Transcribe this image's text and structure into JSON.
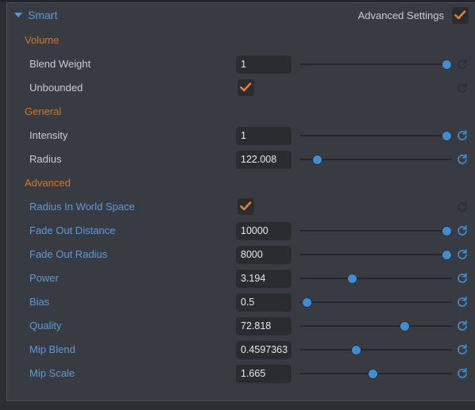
{
  "header": {
    "title": "Smart",
    "disclosure_icon": "triangle-down-icon",
    "advanced_settings_label": "Advanced Settings",
    "advanced_settings_checked": true
  },
  "colors": {
    "panel_bg": "#383c42",
    "section_heading": "#d2762a",
    "label_default": "#c9ccd1",
    "label_modified": "#5b9bd5",
    "accent_blue": "#3d8fd5",
    "accent_orange": "#d2762a",
    "field_bg": "#2a2c30"
  },
  "sections": [
    {
      "name": "Volume",
      "rows": [
        {
          "label": "Blend Weight",
          "label_state": "default",
          "control": "slider",
          "value": "1",
          "slider_pct": 97,
          "reset_state": "inactive"
        },
        {
          "label": "Unbounded",
          "label_state": "default",
          "control": "checkbox",
          "checked": true,
          "reset_state": "inactive"
        }
      ]
    },
    {
      "name": "General",
      "rows": [
        {
          "label": "Intensity",
          "label_state": "default",
          "control": "slider",
          "value": "1",
          "slider_pct": 97,
          "reset_state": "active"
        },
        {
          "label": "Radius",
          "label_state": "default",
          "control": "slider",
          "value": "122.008",
          "slider_pct": 11,
          "reset_state": "active"
        }
      ]
    },
    {
      "name": "Advanced",
      "rows": [
        {
          "label": "Radius In World Space",
          "label_state": "modified",
          "control": "checkbox",
          "checked": true,
          "reset_state": "inactive"
        },
        {
          "label": "Fade Out Distance",
          "label_state": "modified",
          "control": "slider",
          "value": "10000",
          "slider_pct": 97,
          "reset_state": "active"
        },
        {
          "label": "Fade Out Radius",
          "label_state": "modified",
          "control": "slider",
          "value": "8000",
          "slider_pct": 97,
          "reset_state": "active"
        },
        {
          "label": "Power",
          "label_state": "modified",
          "control": "slider",
          "value": "3.194",
          "slider_pct": 34,
          "reset_state": "active"
        },
        {
          "label": "Bias",
          "label_state": "modified",
          "control": "slider",
          "value": "0.5",
          "slider_pct": 4,
          "reset_state": "active"
        },
        {
          "label": "Quality",
          "label_state": "modified",
          "control": "slider",
          "value": "72.818",
          "slider_pct": 69,
          "reset_state": "active"
        },
        {
          "label": "Mip Blend",
          "label_state": "modified",
          "control": "slider",
          "value": "0.4597363",
          "slider_pct": 37,
          "reset_state": "active"
        },
        {
          "label": "Mip Scale",
          "label_state": "modified",
          "control": "slider",
          "value": "1.665",
          "slider_pct": 48,
          "reset_state": "active"
        }
      ]
    }
  ]
}
